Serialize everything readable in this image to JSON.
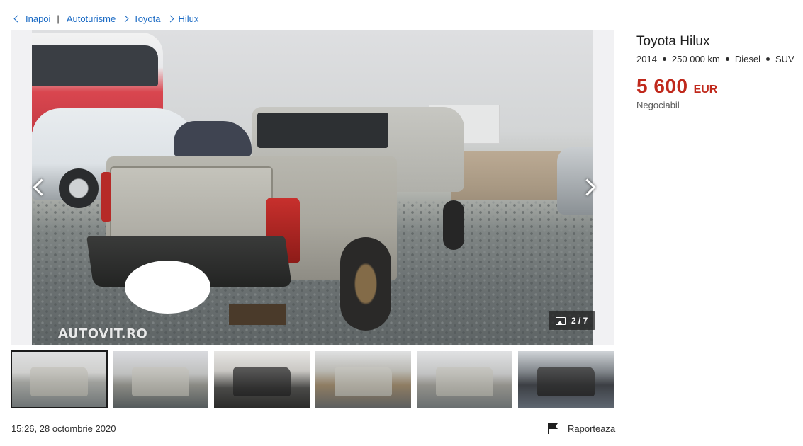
{
  "breadcrumb": {
    "back_label": "Inapoi",
    "items": [
      "Autoturisme",
      "Toyota",
      "Hilux"
    ]
  },
  "gallery": {
    "watermark": "AUTOVIT.RO",
    "counter": "2 / 7",
    "current_index": 2,
    "total": 7,
    "thumbnail_count": 6,
    "active_thumbnail": 1
  },
  "listing": {
    "title": "Toyota Hilux",
    "year": "2014",
    "mileage": "250 000 km",
    "fuel": "Diesel",
    "body": "SUV",
    "price": "5 600",
    "currency": "EUR",
    "negotiable": "Negociabil"
  },
  "footer": {
    "date": "15:26, 28 octombrie 2020",
    "report_label": "Raporteaza"
  },
  "colors": {
    "link": "#1a6ac4",
    "price": "#c0291c",
    "text": "#2c2c2c"
  },
  "icons": {
    "back": "chevron-left-icon",
    "separator": "chevron-right-icon",
    "gallery": "image-stack-icon",
    "report": "flag-icon"
  }
}
